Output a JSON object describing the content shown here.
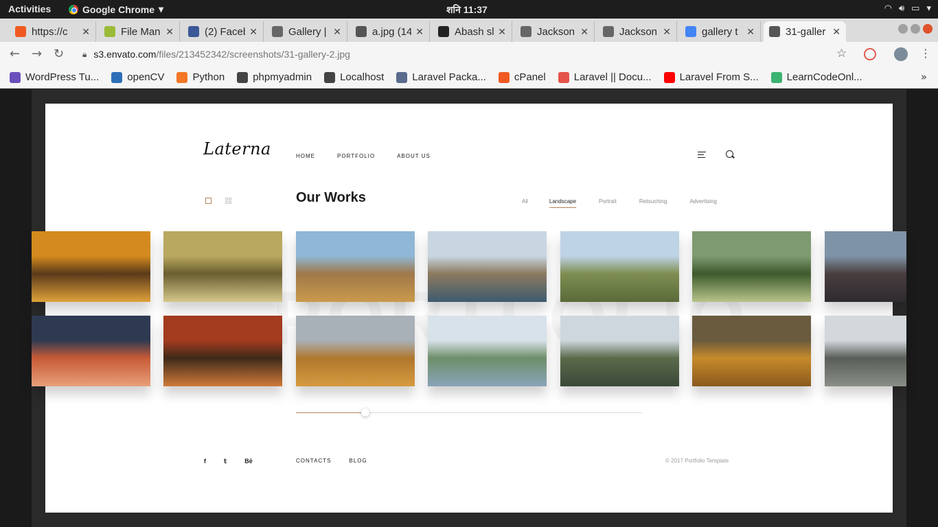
{
  "system": {
    "activities": "Activities",
    "app_name": "Google Chrome",
    "clock": "शनि 11:37"
  },
  "tabs": [
    {
      "title": "https://c",
      "icon": "cpanel-icon",
      "color": "#f05a22"
    },
    {
      "title": "File Man",
      "icon": "file-manager-icon",
      "color": "#9bbb38"
    },
    {
      "title": "(2) Faceb",
      "icon": "facebook-icon",
      "color": "#3b5998"
    },
    {
      "title": "Gallery |",
      "icon": "page-icon",
      "color": "#666666"
    },
    {
      "title": "a.jpg (14",
      "icon": "image-icon",
      "color": "#555555"
    },
    {
      "title": "Abash sl",
      "icon": "site-icon",
      "color": "#222222"
    },
    {
      "title": "Jackson",
      "icon": "page-icon",
      "color": "#666666"
    },
    {
      "title": "Jackson",
      "icon": "page-icon",
      "color": "#666666"
    },
    {
      "title": "gallery t",
      "icon": "google-icon",
      "color": "#4285f4"
    },
    {
      "title": "31-galler",
      "icon": "globe-icon",
      "color": "#555555"
    }
  ],
  "omnibox": {
    "host": "s3.envato.com",
    "path": "/files/213452342/screenshots/31-gallery-2.jpg"
  },
  "bookmarks": [
    {
      "label": "WordPress Tu...",
      "color": "#6b4fbb"
    },
    {
      "label": "openCV",
      "color": "#2d6fb7"
    },
    {
      "label": "Python",
      "color": "#f37626"
    },
    {
      "label": "phpmyadmin",
      "color": "#444444"
    },
    {
      "label": "Localhost",
      "color": "#444444"
    },
    {
      "label": "Laravel Packa...",
      "color": "#5a6b8c"
    },
    {
      "label": "cPanel",
      "color": "#f05a22"
    },
    {
      "label": "Laravel || Docu...",
      "color": "#e5534b"
    },
    {
      "label": "Laravel From S...",
      "color": "#ff0000"
    },
    {
      "label": "LearnCodeOnl...",
      "color": "#3cb371"
    }
  ],
  "site": {
    "logo": "Laterna",
    "nav": [
      "HOME",
      "PORTFOLIO",
      "ABOUT US"
    ],
    "title": "Our Works",
    "filters": [
      "All",
      "Landscape",
      "Portrait",
      "Retouching",
      "Advertising"
    ],
    "active_filter": "Landscape",
    "social": [
      "f",
      "𝕥",
      "Bē"
    ],
    "footer_links": [
      "CONTACTS",
      "BLOG"
    ],
    "copyright": "© 2017 Portfolio Template",
    "slider_progress": 0.2,
    "accent": "#b5865a"
  },
  "gallery": [
    {
      "name": "autumn-branches",
      "colors": [
        "#d48a1e",
        "#5b3a1a",
        "#e0a23a"
      ]
    },
    {
      "name": "yellow-birch-forest",
      "colors": [
        "#b9a860",
        "#6b5e30",
        "#d6c78a"
      ]
    },
    {
      "name": "rocky-valley",
      "colors": [
        "#8fb7d6",
        "#a0784a",
        "#c99a4c"
      ]
    },
    {
      "name": "mountain-lake-reflection",
      "colors": [
        "#c8d6e2",
        "#8c7a60",
        "#3e5a6e"
      ]
    },
    {
      "name": "alpine-meadow-hiker",
      "colors": [
        "#bfd3e6",
        "#7e8e52",
        "#5a6a3a"
      ]
    },
    {
      "name": "lake-with-pine-trees",
      "colors": [
        "#7e9a70",
        "#3e5a2c",
        "#b8c48a"
      ]
    },
    {
      "name": "dark-mountain-peaks",
      "colors": [
        "#7f93a8",
        "#4a3e3e",
        "#2e2a30"
      ]
    },
    {
      "name": "sunset-glacier",
      "colors": [
        "#2e3a52",
        "#c75a36",
        "#e8a07a"
      ]
    },
    {
      "name": "red-berries-branches",
      "colors": [
        "#a33b1e",
        "#3e2a1a",
        "#d07a3a"
      ]
    },
    {
      "name": "golden-hills-road",
      "colors": [
        "#a8b0b8",
        "#b0782e",
        "#d69a40"
      ]
    },
    {
      "name": "snowy-peaks-reflection",
      "colors": [
        "#d8e2ea",
        "#6e8e6a",
        "#8aa4b8"
      ]
    },
    {
      "name": "cloudy-alpine-range",
      "colors": [
        "#cfd7de",
        "#5a6a4a",
        "#3a4838"
      ]
    },
    {
      "name": "autumn-larch-slope",
      "colors": [
        "#6a5a3e",
        "#c68a2a",
        "#8a5a1e"
      ]
    },
    {
      "name": "misty-snowy-ridge",
      "colors": [
        "#d2d8dc",
        "#5a5e58",
        "#8a8e88"
      ]
    }
  ]
}
